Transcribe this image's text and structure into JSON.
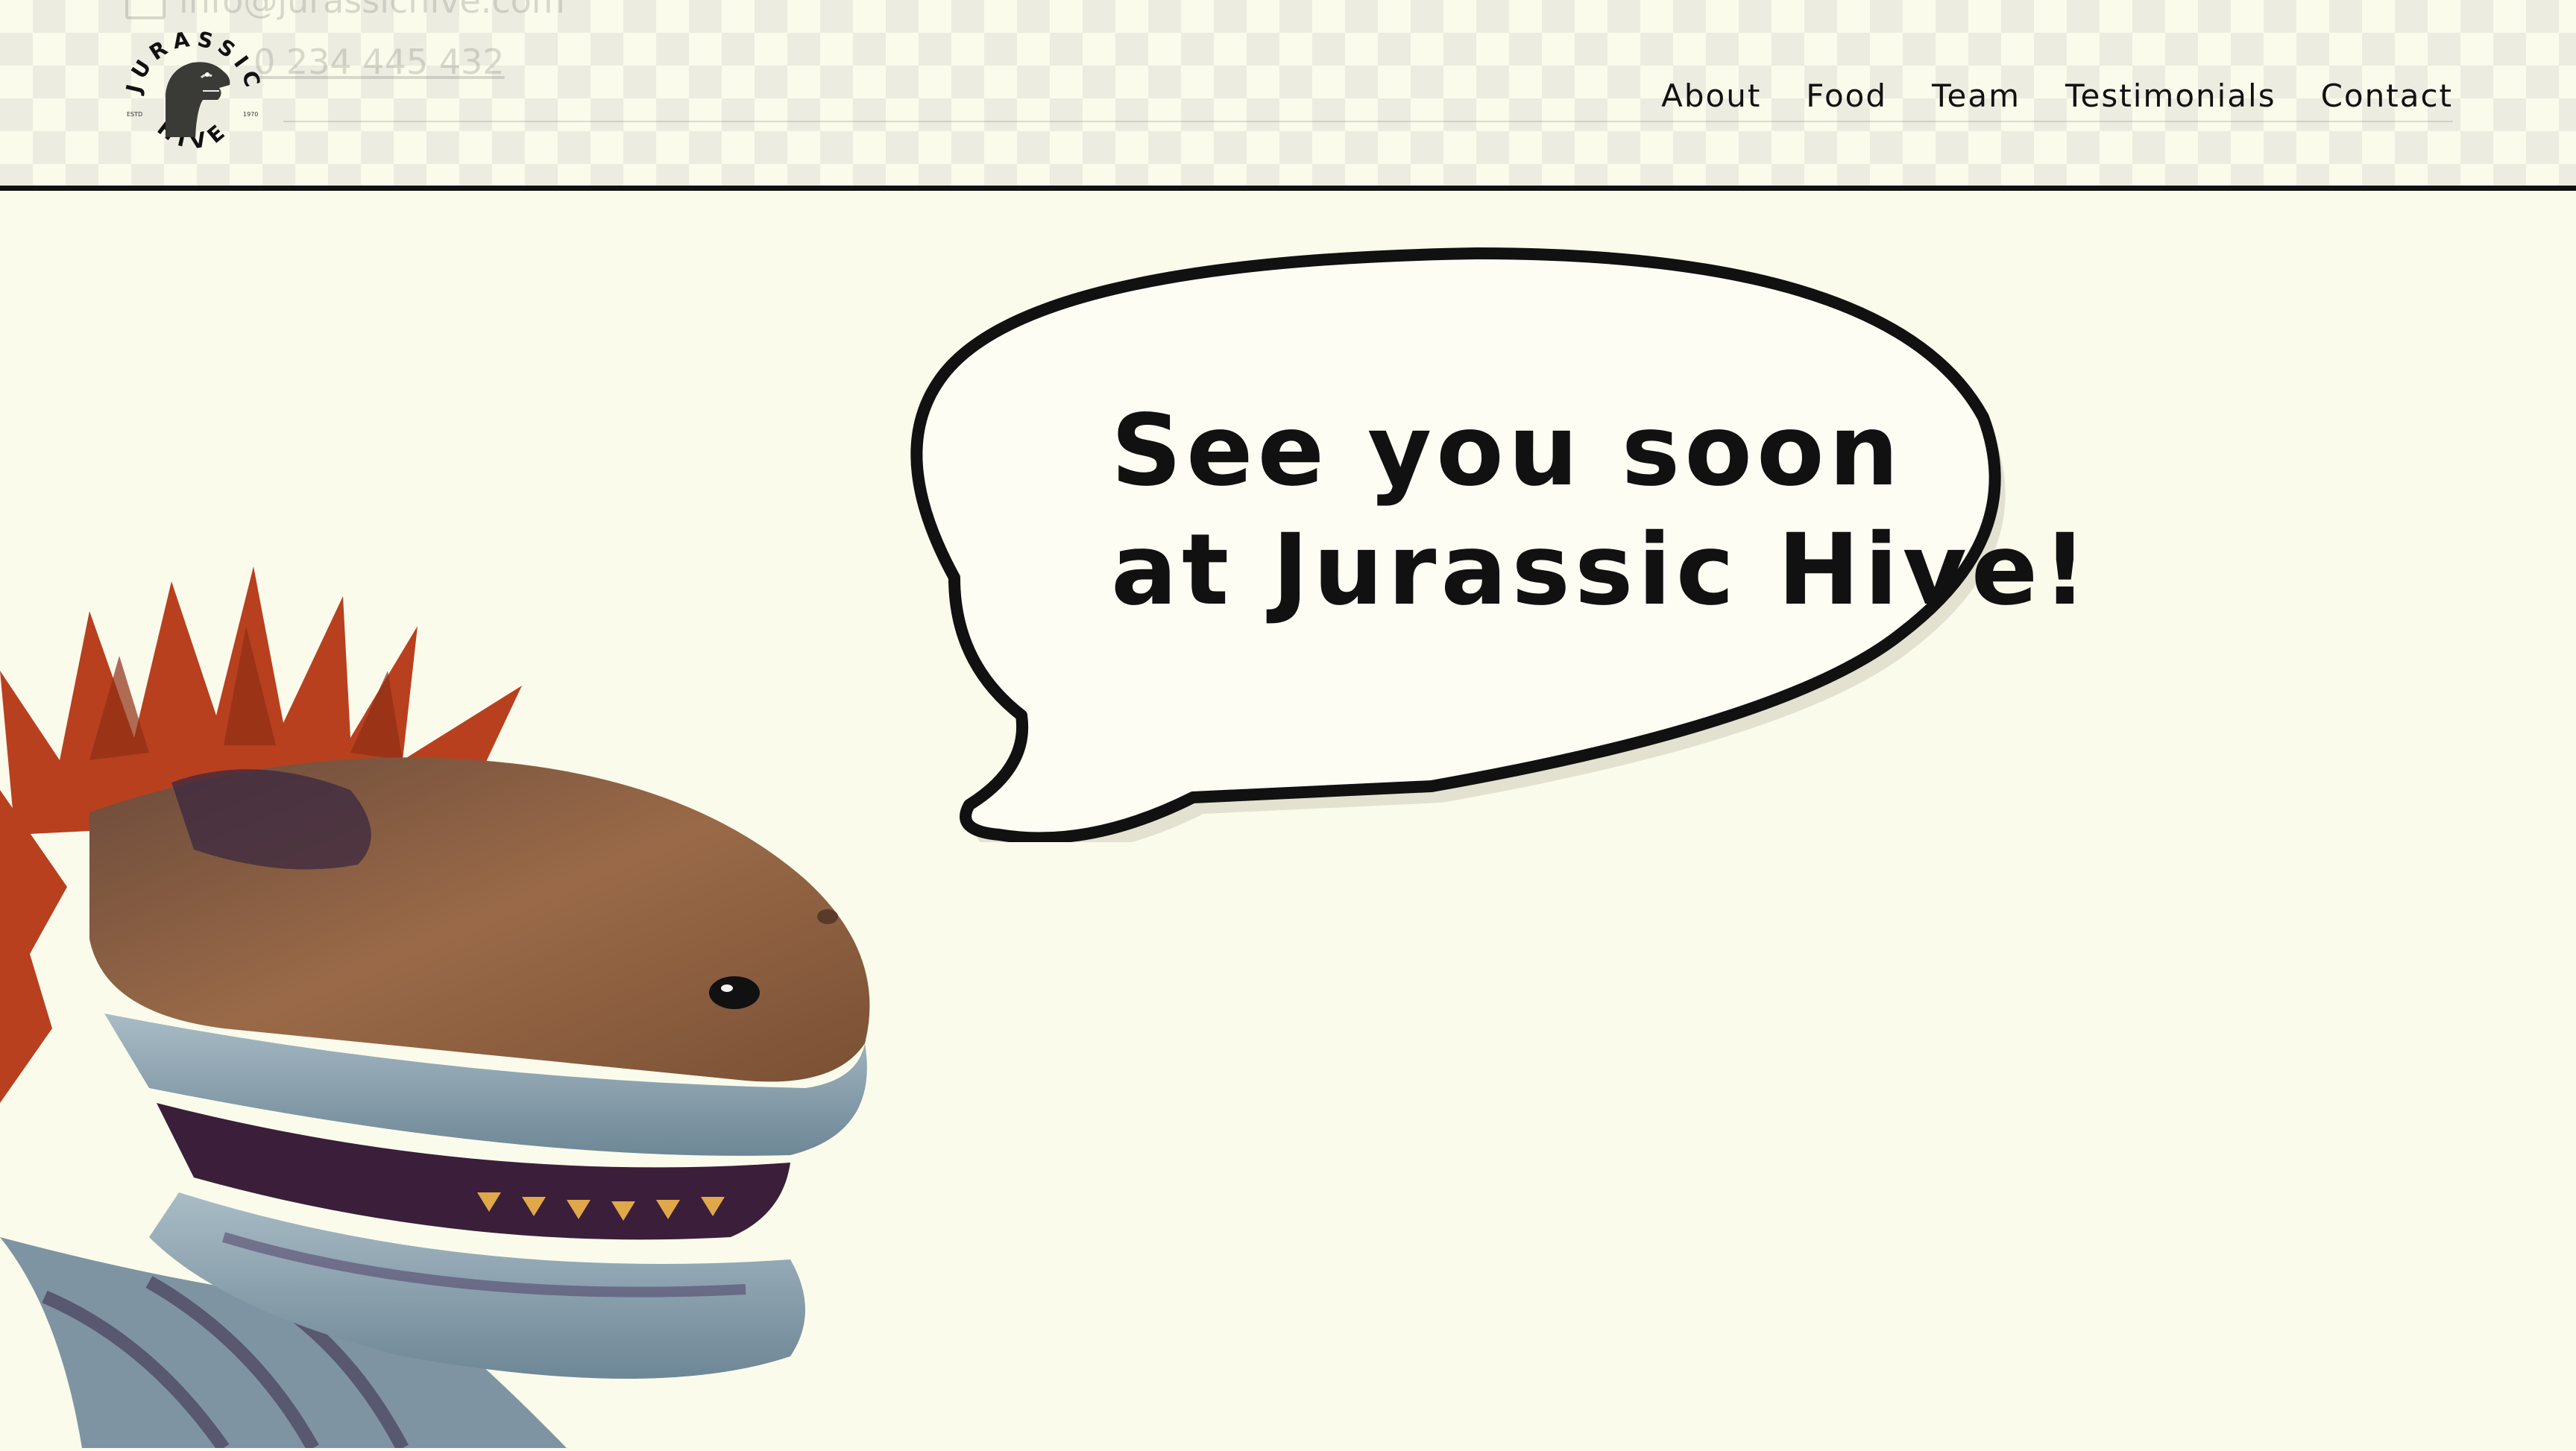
{
  "header": {
    "logo": {
      "top_text": "JURASSIC",
      "bottom_text": "HIVE",
      "left_mark": "ESTD",
      "right_mark": "1970"
    },
    "ghost_email": "info@jurassichive.com",
    "ghost_phone": "0 234 445 432",
    "nav": [
      {
        "label": "About"
      },
      {
        "label": "Food"
      },
      {
        "label": "Team"
      },
      {
        "label": "Testimonials"
      },
      {
        "label": "Contact"
      }
    ]
  },
  "hero": {
    "bubble_line_1": "See you soon",
    "bubble_line_2": "at Jurassic Hive!"
  },
  "colors": {
    "background": "#fbfbec",
    "ink": "#111111",
    "dino_crest": "#b8401f",
    "dino_skin": "#8a5a3a",
    "dino_jaw": "#8fa4b0"
  },
  "icons": {
    "logo": "dinosaur-head-logo",
    "hero_image": "dinosaur-puppet-illustration"
  }
}
